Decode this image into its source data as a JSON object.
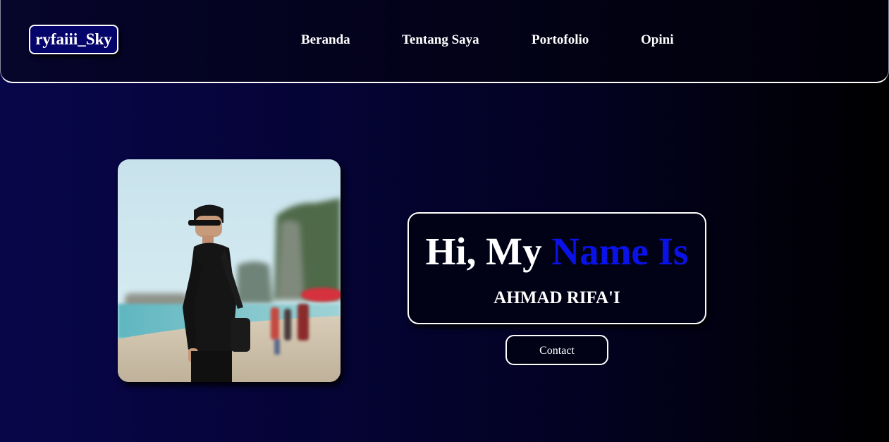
{
  "navbar": {
    "logo": "ryfaiii_Sky",
    "links": [
      "Beranda",
      "Tentang Saya",
      "Portofolio",
      "Opini"
    ]
  },
  "hero": {
    "greeting_prefix": "Hi, My ",
    "greeting_accent": "Name Is",
    "name": "AHMAD RIFA'I",
    "contact_label": "Contact"
  },
  "colors": {
    "accent": "#0a12e8",
    "background_start": "#08064a",
    "background_end": "#000000",
    "border": "#ffffff"
  }
}
